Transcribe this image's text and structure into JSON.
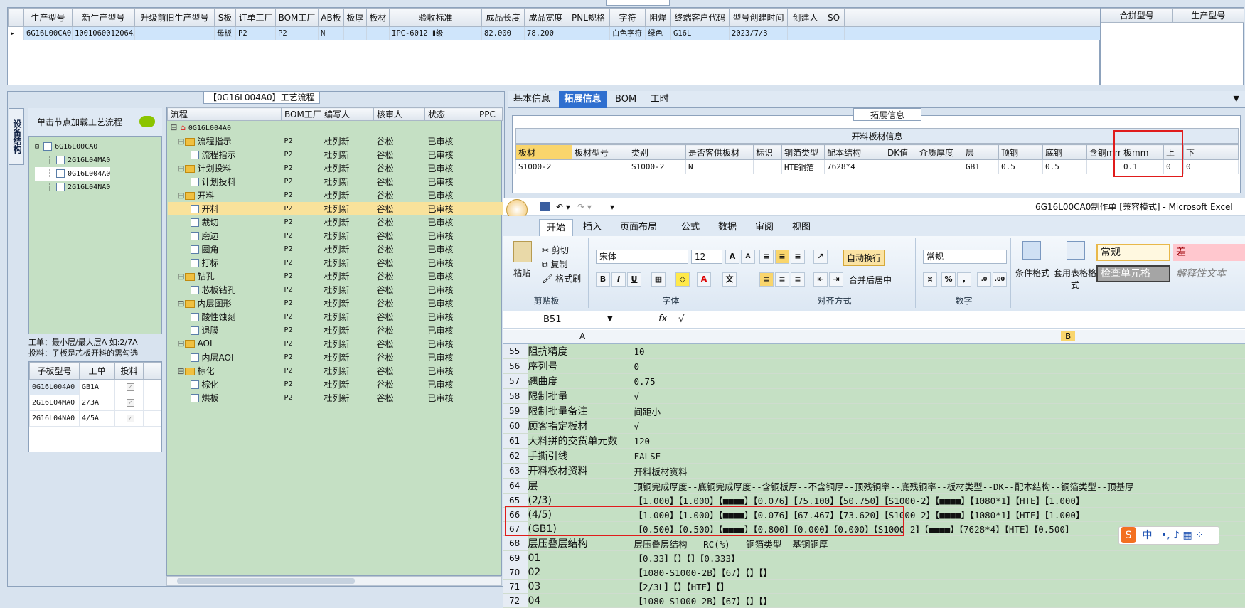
{
  "top_grid": {
    "headers": [
      "生产型号",
      "新生产型号",
      "升级前旧生产型号",
      "S板",
      "订单工厂",
      "BOM工厂",
      "AB板",
      "板厚",
      "板材",
      "验收标准",
      "成品长度",
      "成品宽度",
      "PNL规格",
      "字符",
      "阻焊",
      "终端客户代码",
      "型号创建时间",
      "创建人",
      "SO"
    ],
    "row": [
      "6G16L00CA0",
      "10010600120643",
      "",
      "母板",
      "P2",
      "P2",
      "N",
      "",
      "",
      "IPC-6012 Ⅱ级",
      "82.000",
      "78.200",
      "",
      "白色字符",
      "绿色",
      "G16L",
      "2023/7/3",
      "",
      ""
    ],
    "right_headers": [
      "合拼型号",
      "生产型号"
    ]
  },
  "flow_title": "【0G16L004A0】工艺流程",
  "vertical_tab": "设备结构",
  "node_panel": {
    "header": "单击节点加载工艺流程",
    "nodes": [
      "6G16L00CA0",
      "2G16L04MA0",
      "0G16L004A0",
      "2G16L04NA0"
    ]
  },
  "note": {
    "line1": "工单：最小层/最大层A 如:2/7A",
    "line2": "投料：子板是芯板开料的需勾选"
  },
  "sub_grid": {
    "headers": [
      "子板型号",
      "工单",
      "投料"
    ],
    "rows": [
      [
        "0G16L004A0",
        "GB1A"
      ],
      [
        "2G16L04MA0",
        "2/3A"
      ],
      [
        "2G16L04NA0",
        "4/5A"
      ]
    ]
  },
  "flow_grid": {
    "headers": [
      "流程",
      "BOM工厂",
      "编写人",
      "核审人",
      "状态",
      "PPC"
    ],
    "root": "0G16L004A0",
    "rows": [
      {
        "name": "流程指示",
        "level": 1,
        "factory": "P2",
        "writer": "杜列新",
        "reviewer": "谷松",
        "status": "已审核"
      },
      {
        "name": "流程指示",
        "level": 2,
        "factory": "P2",
        "writer": "杜列新",
        "reviewer": "谷松",
        "status": "已审核"
      },
      {
        "name": "计划投料",
        "level": 1,
        "factory": "P2",
        "writer": "杜列新",
        "reviewer": "谷松",
        "status": "已审核"
      },
      {
        "name": "计划投料",
        "level": 2,
        "factory": "P2",
        "writer": "杜列新",
        "reviewer": "谷松",
        "status": "已审核"
      },
      {
        "name": "开料",
        "level": 1,
        "factory": "P2",
        "writer": "杜列新",
        "reviewer": "谷松",
        "status": "已审核"
      },
      {
        "name": "开料",
        "level": 2,
        "factory": "P2",
        "writer": "杜列新",
        "reviewer": "谷松",
        "status": "已审核"
      },
      {
        "name": "裁切",
        "level": 2,
        "factory": "P2",
        "writer": "杜列新",
        "reviewer": "谷松",
        "status": "已审核"
      },
      {
        "name": "磨边",
        "level": 2,
        "factory": "P2",
        "writer": "杜列新",
        "reviewer": "谷松",
        "status": "已审核"
      },
      {
        "name": "圆角",
        "level": 2,
        "factory": "P2",
        "writer": "杜列新",
        "reviewer": "谷松",
        "status": "已审核"
      },
      {
        "name": "打标",
        "level": 2,
        "factory": "P2",
        "writer": "杜列新",
        "reviewer": "谷松",
        "status": "已审核"
      },
      {
        "name": "钻孔",
        "level": 1,
        "factory": "P2",
        "writer": "杜列新",
        "reviewer": "谷松",
        "status": "已审核"
      },
      {
        "name": "芯板钻孔",
        "level": 2,
        "factory": "P2",
        "writer": "杜列新",
        "reviewer": "谷松",
        "status": "已审核"
      },
      {
        "name": "内层图形",
        "level": 1,
        "factory": "P2",
        "writer": "杜列新",
        "reviewer": "谷松",
        "status": "已审核"
      },
      {
        "name": "酸性蚀刻",
        "level": 2,
        "factory": "P2",
        "writer": "杜列新",
        "reviewer": "谷松",
        "status": "已审核"
      },
      {
        "name": "退膜",
        "level": 2,
        "factory": "P2",
        "writer": "杜列新",
        "reviewer": "谷松",
        "status": "已审核"
      },
      {
        "name": "AOI",
        "level": 1,
        "factory": "P2",
        "writer": "杜列新",
        "reviewer": "谷松",
        "status": "已审核"
      },
      {
        "name": "内层AOI",
        "level": 2,
        "factory": "P2",
        "writer": "杜列新",
        "reviewer": "谷松",
        "status": "已审核"
      },
      {
        "name": "棕化",
        "level": 1,
        "factory": "P2",
        "writer": "杜列新",
        "reviewer": "谷松",
        "status": "已审核"
      },
      {
        "name": "棕化",
        "level": 2,
        "factory": "P2",
        "writer": "杜列新",
        "reviewer": "谷松",
        "status": "已审核"
      },
      {
        "name": "烘板",
        "level": 2,
        "factory": "P2",
        "writer": "杜列新",
        "reviewer": "谷松",
        "status": "已审核"
      }
    ]
  },
  "right_tabs": [
    "基本信息",
    "拓展信息",
    "BOM",
    "工时"
  ],
  "ext_label": "拓展信息",
  "board": {
    "title": "开料板材信息",
    "headers": [
      "板材",
      "板材型号",
      "类别",
      "是否客供板材",
      "标识",
      "铜箔类型",
      "配本结构",
      "DK值",
      "介质厚度",
      "层",
      "顶铜",
      "底铜",
      "含铜mm",
      "板mm",
      "上",
      "下"
    ],
    "row": [
      "S1000-2",
      "",
      "S1000-2",
      "N",
      "",
      "HTE铜箔",
      "7628*4",
      "",
      "",
      "GB1",
      "0.5",
      "0.5",
      "",
      "0.1",
      "0",
      "0"
    ]
  },
  "excel": {
    "doc_title": "6G16L00CA0制作单  [兼容模式] - Microsoft Excel",
    "menu": [
      "开始",
      "插入",
      "页面布局",
      "公式",
      "数据",
      "审阅",
      "视图"
    ],
    "clipboard": {
      "cut": "剪切",
      "copy": "复制",
      "paste": "粘贴",
      "painter": "格式刷",
      "label": "剪贴板"
    },
    "font": {
      "name": "宋体",
      "size": "12",
      "label": "字体"
    },
    "align": {
      "wrap": "自动换行",
      "merge": "合并后居中",
      "label": "对齐方式"
    },
    "number": {
      "format": "常规",
      "label": "数字"
    },
    "styles": {
      "cond": "条件格式",
      "table": "套用表格格式",
      "normal": "常规",
      "bad": "差",
      "check": "检查单元格",
      "explain": "解释性文本"
    },
    "name_box": "B51",
    "formula": "√",
    "col_a": "A",
    "col_b": "B",
    "rows": [
      [
        "55",
        "阻抗精度",
        "10"
      ],
      [
        "56",
        "序列号",
        "0"
      ],
      [
        "57",
        "翘曲度",
        "0.75"
      ],
      [
        "58",
        "限制批量",
        "√"
      ],
      [
        "59",
        "限制批量备注",
        "间距小"
      ],
      [
        "60",
        "顾客指定板材",
        "√"
      ],
      [
        "61",
        "大料拼的交货单元数",
        "120"
      ],
      [
        "62",
        "手撕引线",
        "FALSE"
      ],
      [
        "63",
        "开料板材资料",
        "开料板材资料"
      ],
      [
        "64",
        "层",
        "顶铜完成厚度--底铜完成厚度--含铜板厚--不含铜厚--顶残铜率--底残铜率--板材类型--DK--配本结构--铜箔类型--顶基厚"
      ],
      [
        "65",
        "(2/3)",
        "【1.000】【1.000】【■■■■】【0.076】【75.100】【50.750】【S1000-2】【■■■■】【1080*1】【HTE】【1.000】"
      ],
      [
        "66",
        "(4/5)",
        "【1.000】【1.000】【■■■■】【0.076】【67.467】【73.620】【S1000-2】【■■■■】【1080*1】【HTE】【1.000】"
      ],
      [
        "67",
        "(GB1)",
        "【0.500】【0.500】【■■■■】【0.800】【0.000】【0.000】【S1000-2】【■■■■】【7628*4】【HTE】【0.500】"
      ],
      [
        "68",
        "层压叠层结构",
        "层压叠层结构---RC(%)---铜箔类型--基铜铜厚"
      ],
      [
        "69",
        "01",
        "【0.33】【】【】【0.333】"
      ],
      [
        "70",
        "02",
        "【1080-S1000-2B】【67】【】【】"
      ],
      [
        "71",
        "03",
        "【2/3L】【】【HTE】【】"
      ],
      [
        "72",
        "04",
        "【1080-S1000-2B】【67】【】【】"
      ]
    ]
  },
  "ime": "中"
}
